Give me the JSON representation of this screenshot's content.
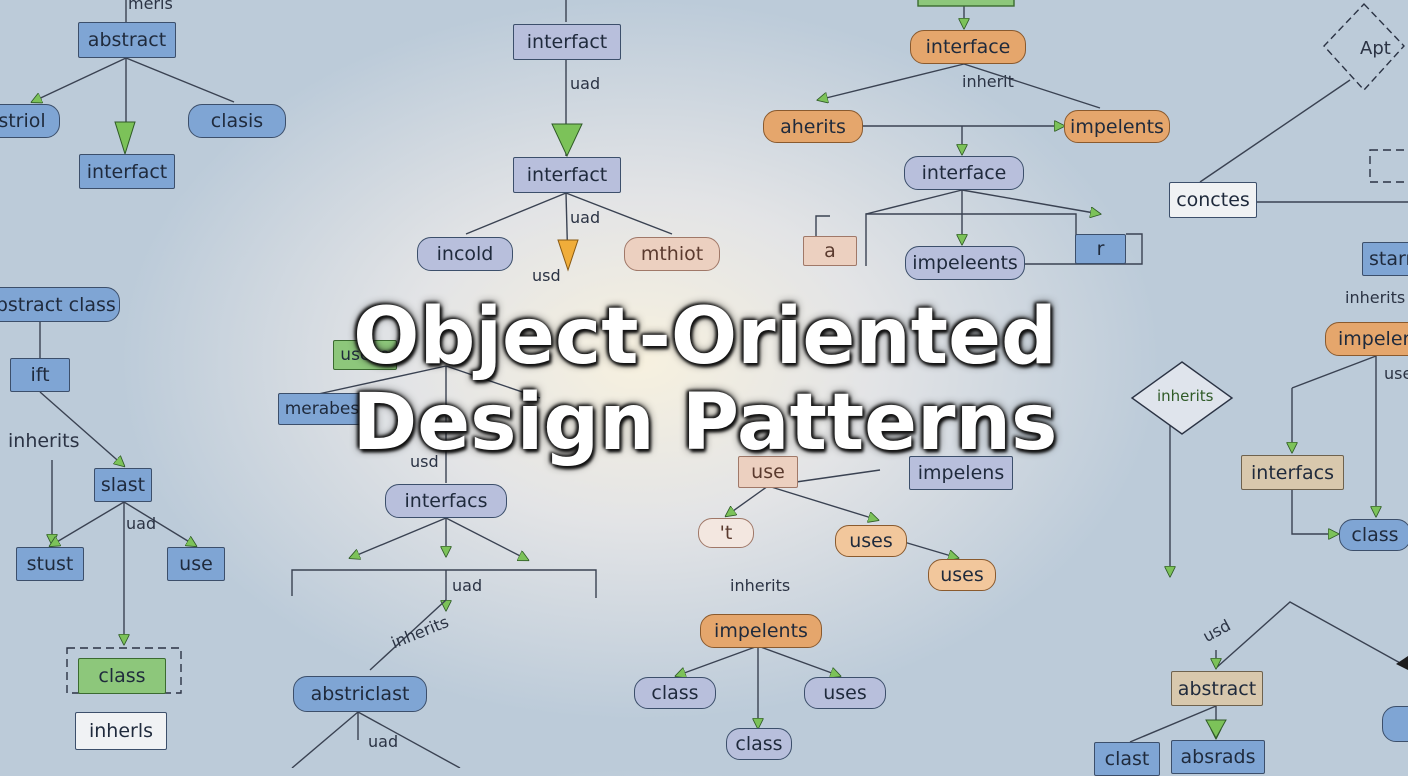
{
  "title": {
    "line1": "Object-Oriented",
    "line2": "Design Patterns"
  },
  "colors": {
    "node_blue": "#7fa5d4",
    "node_lavender": "#b8bfdc",
    "node_orange": "#e5a66c",
    "node_pink": "#ecd0c0",
    "node_tan": "#d8c8ad",
    "node_green": "#8dc77b",
    "arrow_green": "#7cc259",
    "arrow_orange": "#f0ad3a",
    "line": "#3a4252"
  },
  "nodes": {
    "abstract_top": "abstract",
    "striol": "striol",
    "clasis": "clasis",
    "interfact_left": "interfact",
    "abstract_class": "abstract class",
    "ift": "ift",
    "slast": "slast",
    "stust": "stust",
    "use_left": "use",
    "class_green": "class",
    "inherls": "inherls",
    "interfact_top": "interfact",
    "interfact_mid": "interfact",
    "incold": "incold",
    "mthiot": "mthiot",
    "usese": "usese",
    "merabes": "merabes",
    "interfacs_mid": "interfacs",
    "abstriclast": "abstriclast",
    "interface_orange": "interface",
    "aherits": "aherits",
    "impelents_orange": "impelents",
    "interface_mid": "interface",
    "a_box": "a",
    "impeleents": "impeleents",
    "r_box": "r",
    "use_pink": "use",
    "impelens_mid": "impelens",
    "t_pill": "'t",
    "uses_1": "uses",
    "uses_2": "uses",
    "impelents_bottom": "impelents",
    "class_bottom_1": "class",
    "uses_bottom": "uses",
    "class_bottom_2": "class",
    "apt": "Apt",
    "conctes": "conctes",
    "starn": "starn",
    "impeler_right": "impeler",
    "interfacs_right": "interfacs",
    "class_right": "class",
    "abstract_right": "abstract",
    "clast": "clast",
    "absrads": "absrads"
  },
  "labels": {
    "meris": "meris",
    "inherits_left": "inherits",
    "uad_left": "uad",
    "uad_top": "uad",
    "uad_mid": "uad",
    "usd_mid": "usd",
    "usd_center": "usd",
    "uad_bottom": "uad",
    "inherits_diag": "inherits",
    "uad_lower": "uad",
    "inherit_top": "inherit",
    "inherits_center": "inherits",
    "inherits_diamond": "inherits",
    "inherits_right": "inherits",
    "use_right": "use",
    "usd_right": "usd"
  }
}
